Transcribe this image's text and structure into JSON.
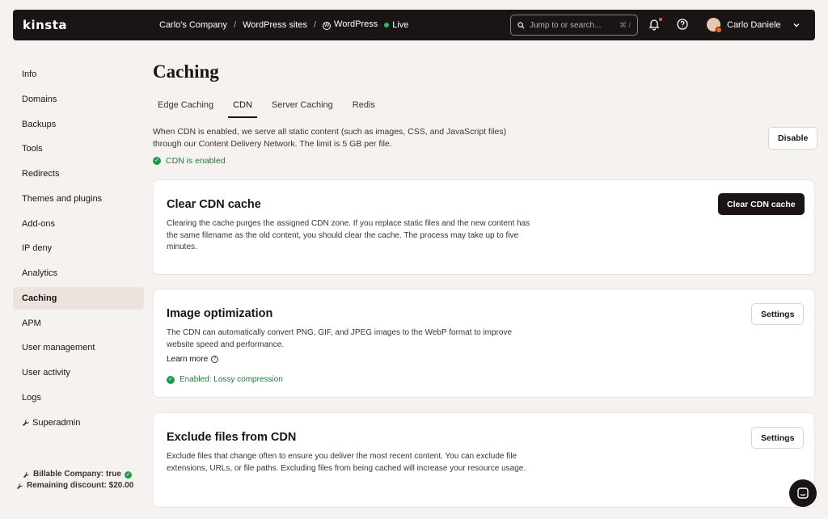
{
  "topbar": {
    "logo": "kinsta",
    "breadcrumbs": [
      "Carlo's Company",
      "WordPress sites",
      "WordPress"
    ],
    "status": "Live",
    "search_placeholder": "Jump to or search...",
    "search_shortcut": "⌘ /",
    "user_name": "Carlo Daniele"
  },
  "sidebar": {
    "items": [
      "Info",
      "Domains",
      "Backups",
      "Tools",
      "Redirects",
      "Themes and plugins",
      "Add-ons",
      "IP deny",
      "Analytics",
      "Caching",
      "APM",
      "User management",
      "User activity",
      "Logs",
      "Superadmin"
    ],
    "active": "Caching",
    "footer": {
      "billable": "Billable Company: true",
      "discount": "Remaining discount: $20.00"
    }
  },
  "main": {
    "title": "Caching",
    "tabs": [
      "Edge Caching",
      "CDN",
      "Server Caching",
      "Redis"
    ],
    "active_tab": "CDN",
    "intro": "When CDN is enabled, we serve all static content (such as images, CSS, and JavaScript files) through our Content Delivery Network. The limit is 5 GB per file.",
    "cdn_status": "CDN is enabled",
    "disable_button": "Disable",
    "cards": {
      "clear": {
        "title": "Clear CDN cache",
        "desc": "Clearing the cache purges the assigned CDN zone. If you replace static files and the new content has the same filename as the old content, you should clear the cache. The process may take up to five minutes.",
        "button": "Clear CDN cache"
      },
      "image": {
        "title": "Image optimization",
        "desc": "The CDN can automatically convert PNG, GIF, and JPEG images to the WebP format to improve website speed and performance.",
        "learn_more": "Learn more",
        "status": "Enabled: Lossy compression",
        "button": "Settings"
      },
      "exclude": {
        "title": "Exclude files from CDN",
        "desc": "Exclude files that change often to ensure you deliver the most recent content. You can exclude file extensions, URLs, or file paths. Excluding files from being cached will increase your resource usage.",
        "button": "Settings"
      }
    }
  },
  "colors": {
    "dark": "#1a1414",
    "background": "#f6f2ef",
    "active_bg": "#ede2dd",
    "success": "#1e9a47",
    "live": "#2ac05f"
  }
}
